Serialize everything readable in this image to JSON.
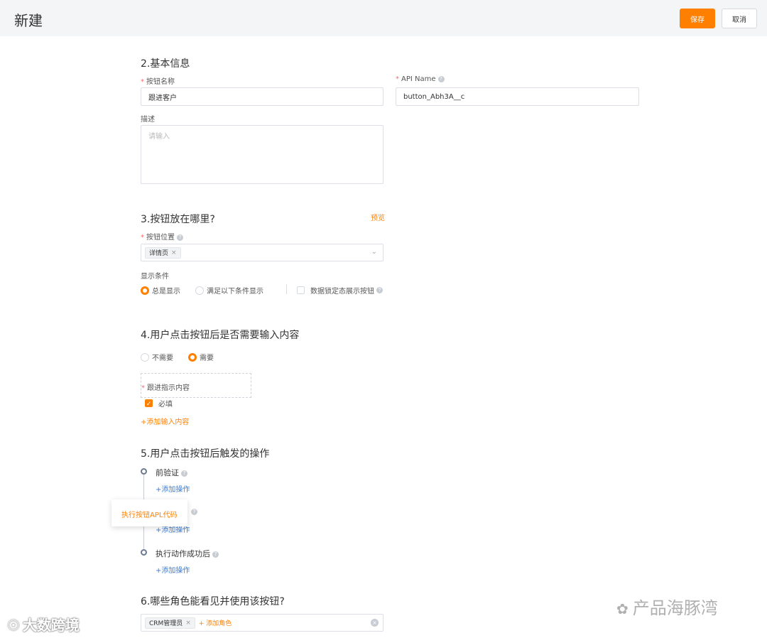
{
  "header": {
    "title": "新建",
    "save_label": "保存",
    "cancel_label": "取消"
  },
  "section2": {
    "heading": "2.基本信息",
    "button_name_label": "按钮名称",
    "button_name_value": "跟进客户",
    "api_name_label": "API Name",
    "api_name_value": "button_Abh3A__c",
    "desc_label": "描述",
    "desc_placeholder": "请输入"
  },
  "section3": {
    "heading": "3.按钮放在哪里?",
    "preview_link": "预览",
    "position_label": "按钮位置",
    "position_tag": "详情页",
    "display_label": "显示条件",
    "opt_always": "总是显示",
    "opt_condition": "满足以下条件显示",
    "lock_checkbox": "数据锁定态展示按钮"
  },
  "section4": {
    "heading": "4.用户点击按钮后是否需要输入内容",
    "opt_no": "不需要",
    "opt_yes": "需要",
    "field_label": "跟进指示内容",
    "required_label": "必填",
    "add_input": "+添加输入内容"
  },
  "section5": {
    "heading": "5.用户点击按钮后触发的操作",
    "step1": "前验证",
    "step1_add": "+添加操作",
    "step2_add": "+添加操作",
    "step3": "执行动作成功后",
    "step3_add": "+添加操作",
    "popup_option": "执行按钮APL代码"
  },
  "section6": {
    "heading": "6.哪些角色能看见并使用该按钮?",
    "role_tag": "CRM管理员",
    "add_role": "+ 添加角色"
  },
  "watermarks": {
    "right": "产品海豚湾",
    "left": "大数跨境"
  },
  "colors": {
    "accent": "#ff8000",
    "link_blue": "#3a7bd5",
    "required": "#f56c6c"
  }
}
